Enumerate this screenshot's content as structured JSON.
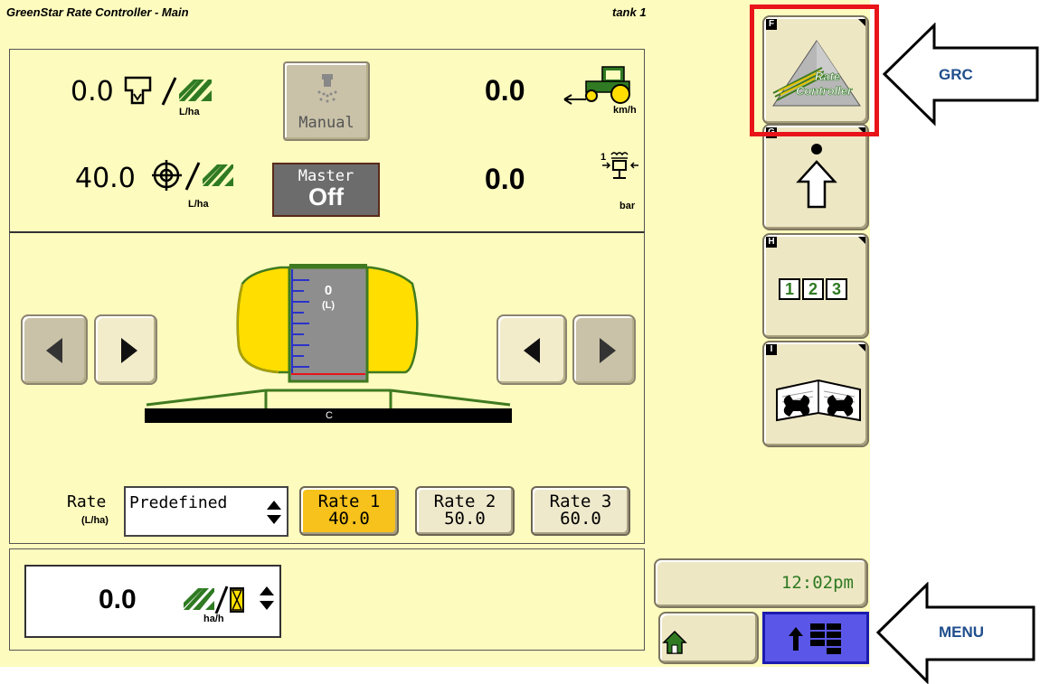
{
  "header": {
    "title": "GreenStar Rate Controller - Main",
    "tank": "tank 1"
  },
  "readouts": {
    "applied_rate": {
      "value": "0.0",
      "unit": "L/ha"
    },
    "target_rate": {
      "value": "40.0",
      "unit": "L/ha"
    },
    "speed": {
      "value": "0.0",
      "unit": "km/h"
    },
    "pressure": {
      "value": "0.0",
      "unit": "bar"
    },
    "work_rate": {
      "value": "0.0",
      "unit": "ha/h"
    }
  },
  "buttons": {
    "manual_label": "Manual",
    "master_label": "Master",
    "master_state": "Off"
  },
  "tank_gauge": {
    "value": "0",
    "unit": "(L)",
    "section_label": "C"
  },
  "rate_selector": {
    "label": "Rate",
    "unit": "(L/ha)",
    "mode": "Predefined",
    "presets": [
      {
        "name": "Rate 1",
        "value": "40.0",
        "selected": true
      },
      {
        "name": "Rate 2",
        "value": "50.0",
        "selected": false
      },
      {
        "name": "Rate 3",
        "value": "60.0",
        "selected": false
      }
    ]
  },
  "clock": "12:02pm",
  "softkeys": [
    {
      "letter": "F",
      "name": "rate-controller",
      "label_line1": "Rate",
      "label_line2": "Controller"
    },
    {
      "letter": "G",
      "name": "upload"
    },
    {
      "letter": "H",
      "name": "numbers",
      "digits": [
        "1",
        "2",
        "3"
      ]
    },
    {
      "letter": "I",
      "name": "settings-manual"
    }
  ],
  "annotations": {
    "grc": "GRC",
    "menu": "MENU",
    "highlight_color": "#e8141a"
  },
  "colors": {
    "screen_bg": "#fdfbbe",
    "jd_green": "#367c2b",
    "jd_yellow": "#ffde00",
    "menu_blue": "#3a3adf"
  }
}
